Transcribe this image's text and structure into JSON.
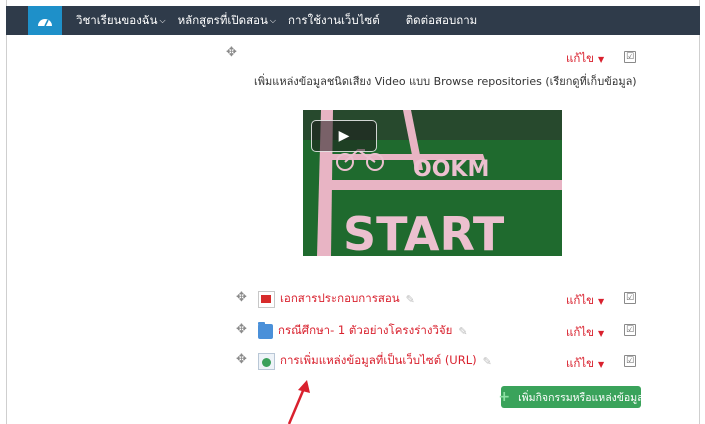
{
  "nav": {
    "items": [
      {
        "label": "วิชาเรียนของฉัน",
        "has_dropdown": true
      },
      {
        "label": "หลักสูตรที่เปิดสอน",
        "has_dropdown": true
      },
      {
        "label": "การใช้งานเว็บไซต์",
        "has_dropdown": false
      },
      {
        "label": "ติดต่อสอบถาม",
        "has_dropdown": false
      }
    ],
    "chevron": "⌵",
    "accent": "#1e90c9",
    "background": "#2f3b4a"
  },
  "icons": {
    "move": "✥",
    "check": "☑",
    "caret": "▼",
    "play": "▶",
    "pencil": "✎",
    "plus": "+"
  },
  "label_block": {
    "description": "เพิ่มแหล่งข้อมูลชนิดเสียง Video แบบ Browse repositories (เรียกดูที่เก็บข้อมูล)",
    "edit_label": "แก้ไข"
  },
  "video": {
    "has_play_button": true
  },
  "activities": [
    {
      "icon": "pdf-icon",
      "title": "เอกสารประกอบการสอน",
      "edit_label": "แก้ไข"
    },
    {
      "icon": "folder-icon",
      "title": "กรณีศึกษา- 1 ตัวอย่างโครงร่างวิจัย",
      "edit_label": "แก้ไข"
    },
    {
      "icon": "url-icon",
      "title": "การเพิ่มแหล่งข้อมูลที่เป็นเว็บไซต์ (URL)",
      "edit_label": "แก้ไข"
    }
  ],
  "add_button": {
    "label": "เพิ่มกิจกรรมหรือแหล่งข้อมูล"
  },
  "colors": {
    "link": "#d9212e",
    "button_green": "#3aa35b",
    "arrow": "#d9212e"
  }
}
